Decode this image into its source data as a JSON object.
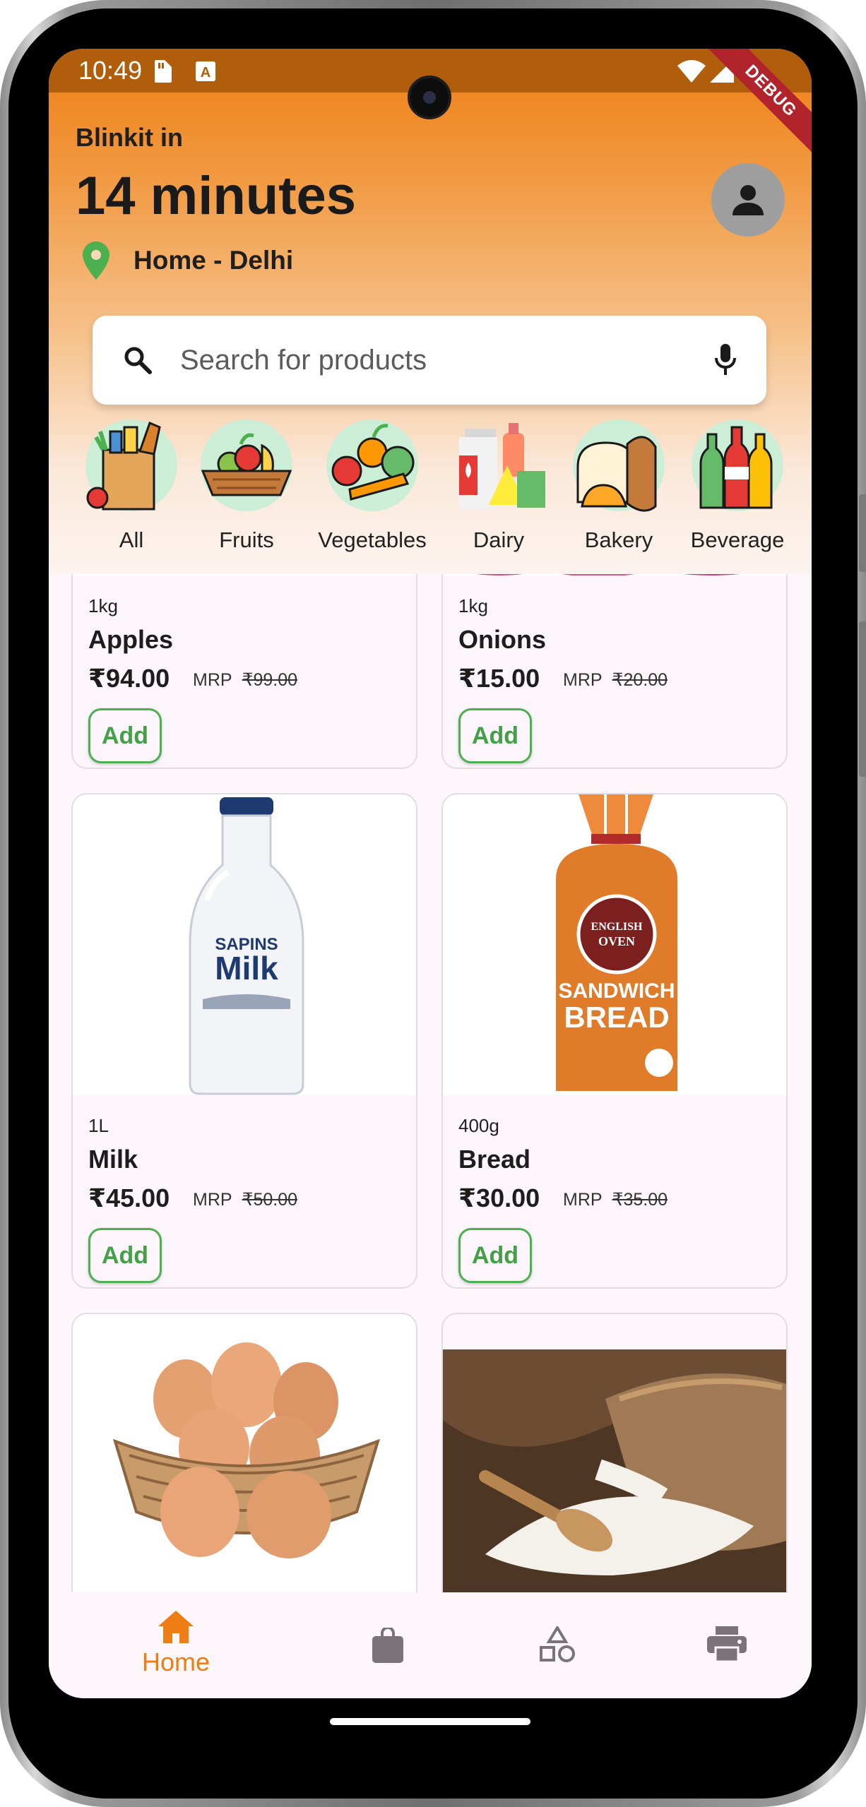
{
  "status": {
    "time": "10:49"
  },
  "debug_banner": "DEBUG",
  "header": {
    "deliver_label": "Blinkit in",
    "delivery_time": "14 minutes",
    "location": "Home - Delhi"
  },
  "search": {
    "placeholder": "Search for products"
  },
  "categories": [
    {
      "label": "All",
      "icon": "grocery-bag-icon"
    },
    {
      "label": "Fruits",
      "icon": "fruit-basket-icon"
    },
    {
      "label": "Vegetables",
      "icon": "vegetables-icon"
    },
    {
      "label": "Dairy",
      "icon": "dairy-icon"
    },
    {
      "label": "Bakery",
      "icon": "bread-icon"
    },
    {
      "label": "Beverage",
      "icon": "bottles-icon"
    }
  ],
  "products": [
    {
      "qty": "1kg",
      "name": "Apples",
      "price": "₹94.00",
      "mrp_label": "MRP",
      "mrp": "₹99.00",
      "add": "Add"
    },
    {
      "qty": "1kg",
      "name": "Onions",
      "price": "₹15.00",
      "mrp_label": "MRP",
      "mrp": "₹20.00",
      "add": "Add"
    },
    {
      "qty": "1L",
      "name": "Milk",
      "price": "₹45.00",
      "mrp_label": "MRP",
      "mrp": "₹50.00",
      "add": "Add"
    },
    {
      "qty": "400g",
      "name": "Bread",
      "price": "₹30.00",
      "mrp_label": "MRP",
      "mrp": "₹35.00",
      "add": "Add"
    },
    {
      "name": "Eggs",
      "image": "eggs-in-basket"
    },
    {
      "name": "Rice",
      "image": "rice-sack"
    }
  ],
  "milk_bottle": {
    "brand": "SAPINS",
    "word": "Milk"
  },
  "bread_pack": {
    "brand_line1": "ENGLISH",
    "brand_line2": "OVEN",
    "line3": "SANDWICH",
    "line4": "BREAD"
  },
  "bottom_nav": {
    "active": "Home",
    "items": [
      {
        "label": "Home",
        "icon": "home-icon"
      },
      {
        "label": "",
        "icon": "shopping-bag-icon"
      },
      {
        "label": "",
        "icon": "categories-shapes-icon"
      },
      {
        "label": "",
        "icon": "printer-icon"
      }
    ]
  },
  "colors": {
    "accent": "#ee7e14",
    "add_green": "#4caf50",
    "status_bar": "#b05d0c"
  }
}
